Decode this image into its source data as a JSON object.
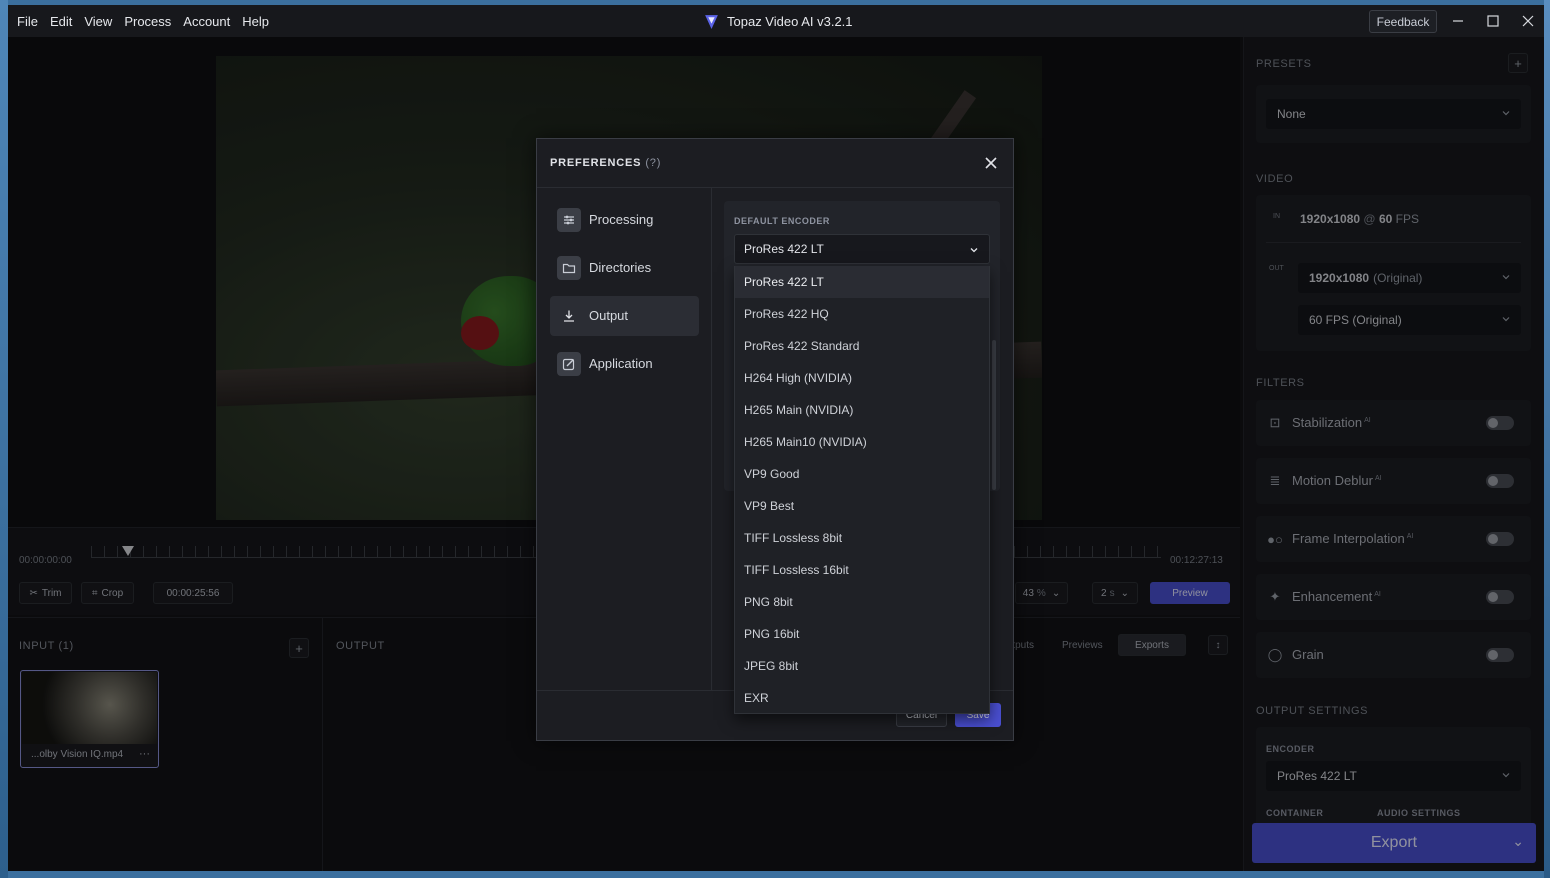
{
  "menu": [
    "File",
    "Edit",
    "View",
    "Process",
    "Account",
    "Help"
  ],
  "app_title": "Topaz Video AI  v3.2.1",
  "feedback_label": "Feedback",
  "timeline": {
    "start_tc": "00:00:00:00",
    "end_tc": "00:12:27:13"
  },
  "toolbar": {
    "trim_label": "Trim",
    "crop_label": "Crop",
    "current_tc": "00:00:25:56",
    "zoom_value": "43",
    "zoom_unit": "%",
    "preview_duration": "2",
    "preview_unit": "s",
    "preview_label": "Preview"
  },
  "input_panel": {
    "title": "INPUT (1)",
    "file_name": "...olby Vision IQ.mp4",
    "more": "···"
  },
  "output_panel": {
    "title": "OUTPUT",
    "tabs": [
      "Outputs",
      "Previews",
      "Exports"
    ],
    "active_tab": "Exports"
  },
  "sidebar": {
    "presets_label": "PRESETS",
    "preset_value": "None",
    "video_label": "VIDEO",
    "in_tag": "IN",
    "in_res": "1920x1080",
    "in_at": "@",
    "in_fps": "60",
    "in_fps_unit": "FPS",
    "out_tag": "OUT",
    "out_res": "1920x1080",
    "out_res_note": "(Original)",
    "out_fps": "60 FPS (Original)",
    "filters_label": "FILTERS",
    "filters": [
      {
        "name": "Stabilization",
        "ai": "AI",
        "icon": "stabilization-icon"
      },
      {
        "name": "Motion Deblur",
        "ai": "AI",
        "icon": "motion-deblur-icon"
      },
      {
        "name": "Frame Interpolation",
        "ai": "AI",
        "icon": "frame-interpolation-icon"
      },
      {
        "name": "Enhancement",
        "ai": "AI",
        "icon": "sparkle-icon"
      },
      {
        "name": "Grain",
        "ai": "",
        "icon": "grain-icon"
      }
    ],
    "output_settings_label": "OUTPUT SETTINGS",
    "encoder_label": "ENCODER",
    "encoder_value": "ProRes 422 LT",
    "container_label": "CONTAINER",
    "audio_label": "AUDIO SETTINGS",
    "export_label": "Export"
  },
  "dialog": {
    "title": "PREFERENCES",
    "help": "(?)",
    "nav": [
      {
        "label": "Processing",
        "icon": "sliders-icon"
      },
      {
        "label": "Directories",
        "icon": "folder-icon"
      },
      {
        "label": "Output",
        "icon": "download-icon"
      },
      {
        "label": "Application",
        "icon": "edit-icon"
      }
    ],
    "active_nav": "Output",
    "default_encoder_label": "DEFAULT ENCODER",
    "default_encoder_value": "ProRes 422 LT",
    "cancel_label": "Cancel",
    "save_label": "Save",
    "encoder_options": [
      "ProRes 422 LT",
      "ProRes 422 HQ",
      "ProRes 422 Standard",
      "H264 High (NVIDIA)",
      "H265 Main (NVIDIA)",
      "H265 Main10 (NVIDIA)",
      "VP9 Good",
      "VP9 Best",
      "TIFF Lossless 8bit",
      "TIFF Lossless 16bit",
      "PNG 8bit",
      "PNG 16bit",
      "JPEG 8bit",
      "EXR"
    ]
  },
  "colors": {
    "accent": "#4a4fd1",
    "background": "#121316",
    "panel": "#1c1d22"
  }
}
